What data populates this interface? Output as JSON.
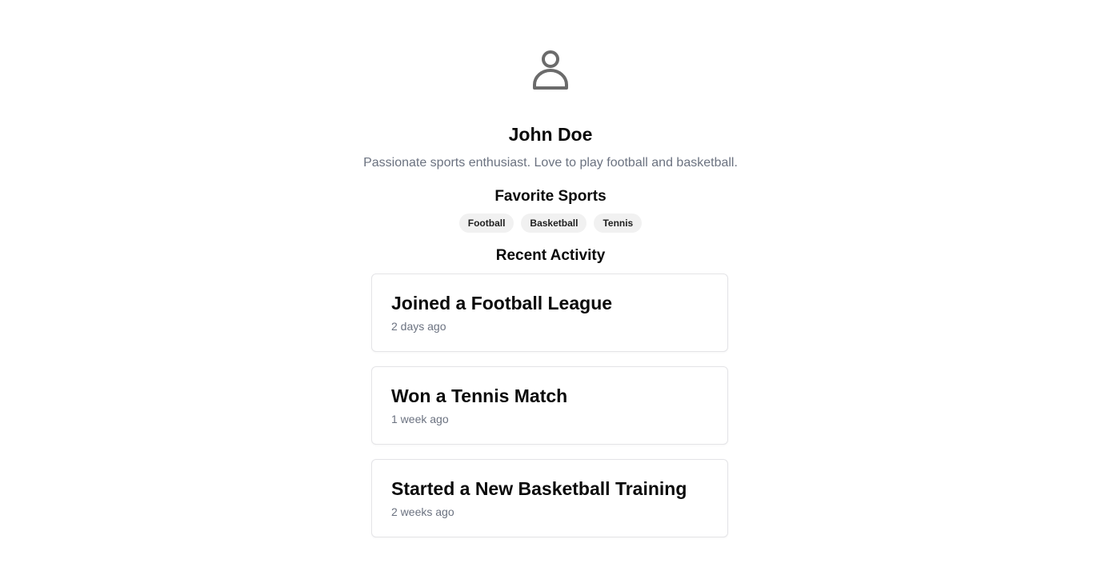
{
  "profile": {
    "avatar_icon": "user-icon",
    "name": "John Doe",
    "bio": "Passionate sports enthusiast. Love to play football and basketball."
  },
  "favorite_sports": {
    "title": "Favorite Sports",
    "tags": [
      "Football",
      "Basketball",
      "Tennis"
    ]
  },
  "recent_activity": {
    "title": "Recent Activity",
    "items": [
      {
        "title": "Joined a Football League",
        "time": "2 days ago"
      },
      {
        "title": "Won a Tennis Match",
        "time": "1 week ago"
      },
      {
        "title": "Started a New Basketball Training",
        "time": "2 weeks ago"
      }
    ]
  },
  "colors": {
    "text": "#0a0a0a",
    "muted": "#6b7280",
    "tag_bg": "#f1f1f1",
    "border": "#e4e4e7",
    "icon": "#6b6b6b"
  }
}
